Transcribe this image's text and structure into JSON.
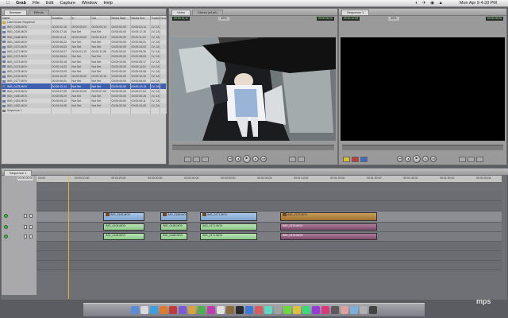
{
  "menubar": {
    "apple": "",
    "app": "Grab",
    "items": [
      "File",
      "Edit",
      "Capture",
      "Window",
      "Help"
    ],
    "clock": "Mon Apr 9  4:33 PM"
  },
  "browser": {
    "tabs": [
      "Browser",
      "Effects"
    ],
    "columns": [
      "Name",
      "Duration",
      "In",
      "Out",
      "Media Start",
      "Media End",
      "Tracks",
      "Good"
    ],
    "rows": [
      {
        "name": "Last Known Sequence",
        "type": "bin",
        "duration": "",
        "in": "",
        "out": "",
        "mstart": "",
        "mend": "",
        "tracks": ""
      },
      {
        "name": "IMG_0105.MOV",
        "type": "clip",
        "duration": "00:00:02;15",
        "in": "00:00:00;00",
        "out": "00:00:02;14",
        "mstart": "00:00:00;00",
        "mend": "00:00:02;14",
        "tracks": "1V, 2A"
      },
      {
        "name": "IMG_0106.MOV",
        "type": "clip",
        "duration": "00:00:17;16",
        "in": "Not Set",
        "out": "Not Set",
        "mstart": "00:00:00;00",
        "mend": "00:00:17;15",
        "tracks": "1V, 2A"
      },
      {
        "name": "IMG_0168.MOV",
        "type": "clip",
        "duration": "00:00:11;11",
        "in": "00:00:00;00",
        "out": "00:00:11;10",
        "mstart": "00:00:00;00",
        "mend": "00:00:11;10",
        "tracks": "1V, 2A"
      },
      {
        "name": "IMG_0169.MOV",
        "type": "clip",
        "duration": "00:00:06;22",
        "in": "Not Set",
        "out": "Not Set",
        "mstart": "00:00:00;00",
        "mend": "00:00:06;21",
        "tracks": "1V, 2A"
      },
      {
        "name": "IMG_0170.MOV",
        "type": "clip",
        "duration": "00:00:04;03",
        "in": "Not Set",
        "out": "Not Set",
        "mstart": "00:00:00;00",
        "mend": "00:00:04;02",
        "tracks": "1V, 2A"
      },
      {
        "name": "IMG_0171.MOV",
        "type": "clip",
        "duration": "00:00:09;27",
        "in": "00:00:01;10",
        "out": "00:00:11;06",
        "mstart": "00:00:00;00",
        "mend": "00:00:09;26",
        "tracks": "1V, 2A"
      },
      {
        "name": "IMG_0172.MOV",
        "type": "clip",
        "duration": "00:00:08;04",
        "in": "Not Set",
        "out": "Not Set",
        "mstart": "00:00:00;00",
        "mend": "00:00:08;03",
        "tracks": "1V, 2A"
      },
      {
        "name": "IMG_0173.MOV",
        "type": "clip",
        "duration": "00:00:05;18",
        "in": "Not Set",
        "out": "Not Set",
        "mstart": "00:00:00;00",
        "mend": "00:00:05;17",
        "tracks": "1V, 2A"
      },
      {
        "name": "IMG_0174.MOV",
        "type": "clip",
        "duration": "00:00:14;02",
        "in": "Not Set",
        "out": "Not Set",
        "mstart": "00:00:00;00",
        "mend": "00:00:14;01",
        "tracks": "1V, 2A"
      },
      {
        "name": "IMG_0175.MOV",
        "type": "clip",
        "duration": "00:00:03;09",
        "in": "Not Set",
        "out": "Not Set",
        "mstart": "00:00:00;00",
        "mend": "00:00:03;08",
        "tracks": "1V, 2A"
      },
      {
        "name": "IMG_0176.MOV",
        "type": "clip",
        "duration": "00:00:10;20",
        "in": "00:00:00;00",
        "out": "00:00:10;19",
        "mstart": "00:00:00;00",
        "mend": "00:00:10;19",
        "tracks": "1V, 2A"
      },
      {
        "name": "IMG_0177.MOV",
        "type": "clip",
        "duration": "00:00:06;01",
        "in": "Not Set",
        "out": "Not Set",
        "mstart": "00:00:00;00",
        "mend": "00:00:06;00",
        "tracks": "1V, 2A"
      },
      {
        "name": "IMG_0178.MOV",
        "type": "clip",
        "duration": "00:00:12;14",
        "in": "Not Set",
        "out": "Not Set",
        "mstart": "00:00:00;00",
        "mend": "00:00:12;13",
        "tracks": "1V, 2A",
        "selected": true
      },
      {
        "name": "IMG_0179.MOV",
        "type": "clip",
        "duration": "00:00:07;05",
        "in": "00:00:00;00",
        "out": "00:00:07;04",
        "mstart": "00:00:00;00",
        "mend": "00:00:07;04",
        "tracks": "1V, 2A"
      },
      {
        "name": "IMG_0180.MOV",
        "type": "clip",
        "duration": "00:00:05;29",
        "in": "Not Set",
        "out": "Not Set",
        "mstart": "00:00:00;00",
        "mend": "00:00:05;28",
        "tracks": "1V, 2A"
      },
      {
        "name": "IMG_0181.MOV",
        "type": "clip",
        "duration": "00:00:09;12",
        "in": "Not Set",
        "out": "Not Set",
        "mstart": "00:00:00;00",
        "mend": "00:00:09;11",
        "tracks": "1V, 2A"
      },
      {
        "name": "IMG_0182.MOV",
        "type": "clip",
        "duration": "00:00:04;26",
        "in": "Not Set",
        "out": "Not Set",
        "mstart": "00:00:00;00",
        "mend": "00:00:04;25",
        "tracks": "1V, 2A"
      },
      {
        "name": "Sequence 1",
        "type": "seq",
        "duration": "",
        "in": "",
        "out": "",
        "mstart": "",
        "mend": "",
        "tracks": ""
      }
    ]
  },
  "viewer": {
    "tabs": [
      "Video",
      "Stereo (a1a2)"
    ],
    "timecode_left": "00:00:11;11",
    "timecode_right": "00:00:00;00",
    "zoom": "40%"
  },
  "canvas": {
    "tabs": [
      "Sequence 1"
    ],
    "timecode_left": "00:00:12;09",
    "timecode_right": "00:00:00;00",
    "zoom": "40%"
  },
  "timeline": {
    "tabs": [
      "Sequence 1"
    ],
    "current_time": "00:00:00;00",
    "ruler": [
      "00:00",
      "00:00:10;00",
      "00:00:20;00",
      "00:00:30;00",
      "00:00:40;00",
      "00:00:50;00",
      "00:01:00;02",
      "00:01:10;02",
      "00:01:20;02",
      "00:01:30;02",
      "00:01:40;02",
      "00:01:50;02",
      "00:02:00;04"
    ],
    "clips": {
      "v1": [
        "IMG_0106.MOV",
        "IMG_0168.MOV",
        "IMG_0171.MOV",
        "IMG_0176.MOV"
      ],
      "a1": [
        "IMG_0106.MOV",
        "IMG_0168.MOV",
        "IMG_0171.MOV",
        "IMG_0176.MOV"
      ],
      "a2": [
        "IMG_0106.MOV",
        "IMG_0168.MOV",
        "IMG_0171.MOV",
        "IMG_0176.MOV"
      ]
    }
  },
  "watermark": "mps"
}
